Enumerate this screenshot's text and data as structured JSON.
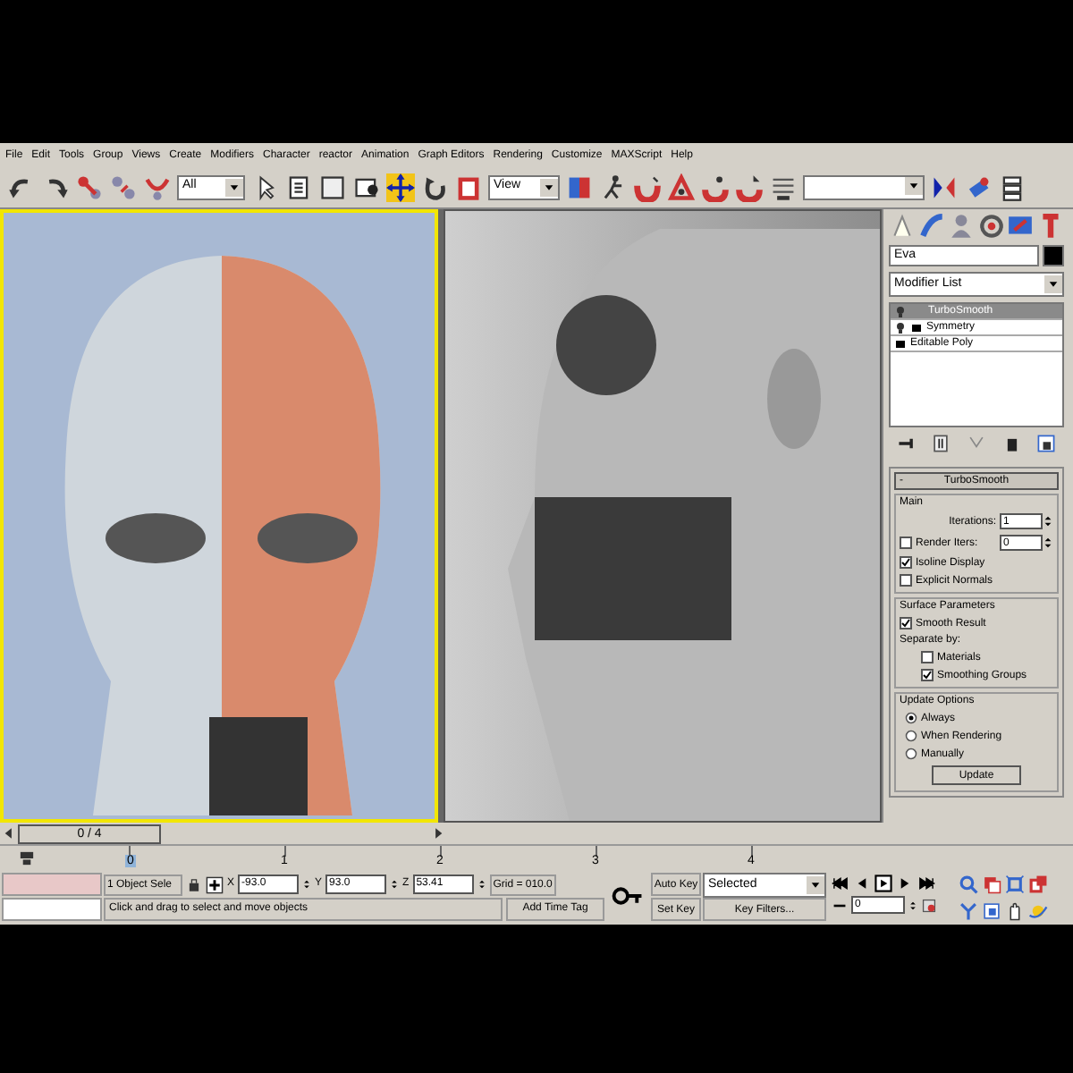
{
  "menu": [
    "File",
    "Edit",
    "Tools",
    "Group",
    "Views",
    "Create",
    "Modifiers",
    "Character",
    "reactor",
    "Animation",
    "Graph Editors",
    "Rendering",
    "Customize",
    "MAXScript",
    "Help"
  ],
  "toolbar": {
    "selection_filter": "All",
    "reference_coord": "View"
  },
  "command_panel": {
    "object_name": "Eva",
    "modifier_list": "Modifier List",
    "stack": [
      {
        "label": "TurboSmooth",
        "selected": true,
        "kind": "bulb"
      },
      {
        "label": "Symmetry",
        "selected": false,
        "kind": "bulb-box"
      },
      {
        "label": "Editable Poly",
        "selected": false,
        "kind": "box"
      }
    ],
    "rollout": {
      "title": "TurboSmooth",
      "toggle": "-",
      "groups": [
        {
          "title": "Main",
          "items": [
            {
              "kind": "spinner",
              "label": "Iterations:",
              "value": "1"
            },
            {
              "kind": "check-spinner",
              "label": "Render Iters:",
              "value": "0",
              "checked": false
            },
            {
              "kind": "checkbox",
              "label": "Isoline Display",
              "checked": true
            },
            {
              "kind": "checkbox",
              "label": "Explicit Normals",
              "checked": false
            }
          ]
        },
        {
          "title": "Surface Parameters",
          "items": [
            {
              "kind": "checkbox",
              "label": "Smooth Result",
              "checked": true
            },
            {
              "kind": "text",
              "label": "Separate by:"
            },
            {
              "kind": "subcheckbox",
              "label": "Materials",
              "checked": false
            },
            {
              "kind": "subcheckbox",
              "label": "Smoothing Groups",
              "checked": true
            }
          ]
        },
        {
          "title": "Update Options",
          "items": [
            {
              "kind": "radio",
              "label": "Always",
              "selected": true
            },
            {
              "kind": "radio",
              "label": "When Rendering",
              "selected": false
            },
            {
              "kind": "radio",
              "label": "Manually",
              "selected": false
            },
            {
              "kind": "button",
              "label": "Update"
            }
          ]
        }
      ]
    }
  },
  "time_slider": {
    "label": "0 / 4",
    "level": 0
  },
  "track_ticks": [
    "0",
    "1",
    "2",
    "3",
    "4"
  ],
  "status": {
    "selection": "1 Object Sele",
    "coords": [
      {
        "axis": "X",
        "value": "-93.0"
      },
      {
        "axis": "Y",
        "value": "93.0"
      },
      {
        "axis": "Z",
        "value": "53.41"
      }
    ],
    "grid": "Grid = 010.0",
    "prompt": "Click and drag to select and move objects",
    "add_time_tag": "Add Time Tag"
  },
  "animation": {
    "auto_key": "Auto Key",
    "key_mode": "Selected",
    "set_key": "Set Key",
    "key_filters": "Key Filters...",
    "current_frame": "0"
  }
}
